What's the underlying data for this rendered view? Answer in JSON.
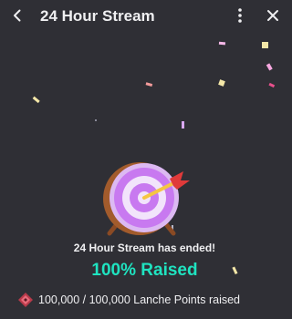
{
  "header": {
    "title": "24 Hour Stream",
    "back_icon": "chevron-left-icon",
    "more_icon": "vertical-dots-icon",
    "close_icon": "close-icon"
  },
  "main": {
    "illustration": "target-with-arrow-icon",
    "ended_text": "24 Hour Stream has ended!",
    "raised_text": "100% Raised",
    "points_icon": "channel-points-icon",
    "points_text": "100,000 / 100,000 Lanche Points raised"
  },
  "colors": {
    "background": "#2f2f35",
    "accent": "#1fe3c0",
    "text": "#efeff1",
    "target_purple": "#c879f0",
    "arrow_red": "#e03a3a"
  }
}
